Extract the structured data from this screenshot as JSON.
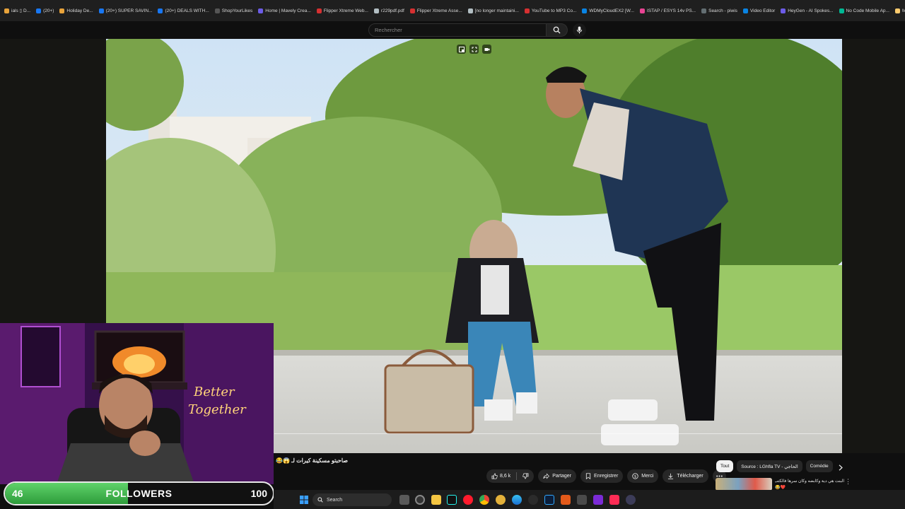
{
  "bookmarks": [
    {
      "label": "ials ▯ D...",
      "color": "#e8a33b"
    },
    {
      "label": "(20+)",
      "color": "#1877f2"
    },
    {
      "label": "Holiday De...",
      "color": "#e8a33b"
    },
    {
      "label": "(20+) SUPER SAVIN...",
      "color": "#1877f2"
    },
    {
      "label": "(20+) DEALS WITH...",
      "color": "#1877f2"
    },
    {
      "label": "ShopYourLikes",
      "color": "#555555"
    },
    {
      "label": "Home | Mavely Crea...",
      "color": "#6c5ce7"
    },
    {
      "label": "Flipper Xtreme Web...",
      "color": "#d63031"
    },
    {
      "label": "r229pdf.pdf",
      "color": "#b2bec3"
    },
    {
      "label": "Flipper Xtreme Asse...",
      "color": "#d63031"
    },
    {
      "label": "[no longer maintaini...",
      "color": "#b2bec3"
    },
    {
      "label": "YouTube to MP3 Co...",
      "color": "#d63031"
    },
    {
      "label": "WDMyCloudEX2 [W...",
      "color": "#0984e3"
    },
    {
      "label": "ISTAP / ESYS 14v PS...",
      "color": "#e84393"
    },
    {
      "label": "Search - piwis",
      "color": "#636e72"
    },
    {
      "label": "Video Editor",
      "color": "#0984e3"
    },
    {
      "label": "HeyGen - AI Spokes...",
      "color": "#6c5ce7"
    },
    {
      "label": "No Code Mobile Ap...",
      "color": "#00b894"
    },
    {
      "label": "MD5 File Checksum...",
      "color": "#fdcb6e"
    }
  ],
  "search": {
    "placeholder": "Rechercher"
  },
  "video": {
    "title": "صاحبتو مسكينة كيرات لـ 😱😂",
    "actions": {
      "likes": "8,6 k",
      "share": "Partager",
      "save": "Enregistrer",
      "thanks": "Merci",
      "download": "Télécharger"
    }
  },
  "chips": [
    {
      "label": "Tout",
      "active": true
    },
    {
      "label": "Source : LGhfla TV - الحاجي",
      "active": false
    },
    {
      "label": "Comédie",
      "active": false
    }
  ],
  "recommendation": {
    "title": "البنت هي دية وكابضه وكان سرها فالكتب",
    "emojis": "😂❤️"
  },
  "stream": {
    "followers_label": "FOLLOWERS",
    "current": "46",
    "goal": "100",
    "progress": 0.46
  },
  "taskbar": {
    "search_label": "Search"
  },
  "colors": {
    "accent_green": "#4cc85a",
    "yt_bg": "#0f0f0f"
  }
}
